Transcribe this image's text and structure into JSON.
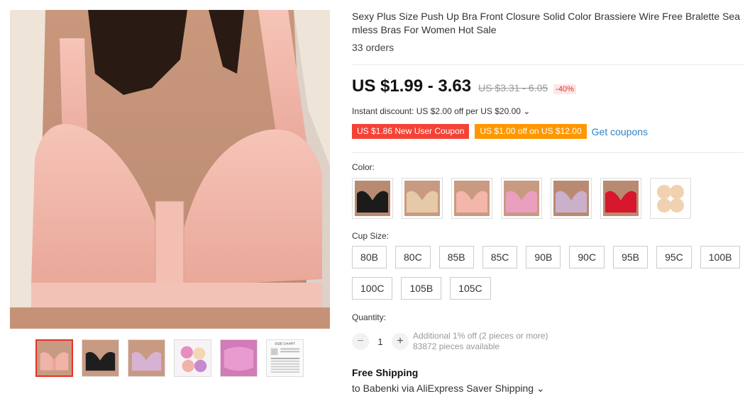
{
  "product": {
    "title": "Sexy Plus Size Push Up Bra Front Closure Solid Color Brassiere Wire Free Bralette Seamless Bras For Women Hot Sale",
    "orders": "33 orders"
  },
  "price": {
    "current": "US $1.99 - 3.63",
    "original": "US $3.31 - 6.05",
    "discount": "-40%"
  },
  "instant_discount": "Instant discount: US $2.00 off per US $20.00 ⌄",
  "coupons": {
    "new_user": "US $1.86 New User Coupon",
    "store": "US $1.00 off on US $12.00",
    "get_label": "Get coupons"
  },
  "color": {
    "label": "Color:",
    "options": [
      "black",
      "beige",
      "pink",
      "rose",
      "purple",
      "red",
      "nipple-cover"
    ]
  },
  "cup_size": {
    "label": "Cup Size:",
    "options": [
      "80B",
      "80C",
      "85B",
      "85C",
      "90B",
      "90C",
      "95B",
      "95C",
      "100B",
      "100C",
      "105B",
      "105C"
    ]
  },
  "quantity": {
    "label": "Quantity:",
    "value": "1",
    "minus": "−",
    "plus": "+",
    "note": "Additional 1% off (2 pieces or more)",
    "available": "83872 pieces available"
  },
  "shipping": {
    "title": "Free Shipping",
    "destination": "to Babenki via AliExpress Saver Shipping ⌄"
  },
  "thumbnails": {
    "size_chart_label": "SIZE CHART"
  },
  "colors": {
    "accent_red": "#e43225",
    "coupon_red": "#f44336",
    "coupon_orange": "#ff9800",
    "link_blue": "#2e83c9",
    "bra_pink": "#f0b3a8"
  }
}
